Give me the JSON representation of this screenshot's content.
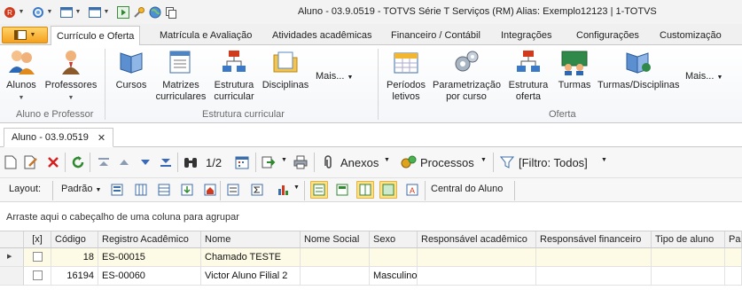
{
  "window": {
    "title": "Aluno - 03.9.0519 - TOTVS Série T Serviços (RM) Alias: Exemplo12123 | 1-TOTVS"
  },
  "quick_access": {
    "icons": [
      "refresh-icon",
      "window-icon",
      "window-icon",
      "play-icon",
      "settings-icon",
      "globe-icon",
      "copy-icon"
    ]
  },
  "ribbon": {
    "tabs": [
      "Currículo e Oferta",
      "Matrícula e Avaliação",
      "Atividades acadêmicas",
      "Financeiro / Contábil",
      "Integrações",
      "Configurações",
      "Customização"
    ],
    "active_tab": "Currículo e Oferta",
    "groups": {
      "aluno_prof": {
        "label": "Aluno e Professor",
        "buttons": [
          {
            "label": "Alunos",
            "icon": "students-icon"
          },
          {
            "label": "Professores",
            "icon": "teacher-icon"
          }
        ]
      },
      "estrutura": {
        "label": "Estrutura curricular",
        "buttons": [
          {
            "label": "Cursos",
            "icon": "book-icon"
          },
          {
            "label": "Matrizes",
            "label2": "curriculares",
            "icon": "matrix-icon"
          },
          {
            "label": "Estrutura",
            "label2": "curricular",
            "icon": "structure-icon"
          },
          {
            "label": "Disciplinas",
            "icon": "folder-icon"
          }
        ],
        "more": "Mais..."
      },
      "oferta": {
        "label": "Oferta",
        "buttons": [
          {
            "label": "Períodos",
            "label2": "letivos",
            "icon": "calendar-icon"
          },
          {
            "label": "Parametrização",
            "label2": "por curso",
            "icon": "gears-icon"
          },
          {
            "label": "Estrutura",
            "label2": "oferta",
            "icon": "structure-icon"
          },
          {
            "label": "Turmas",
            "icon": "class-icon"
          },
          {
            "label": "Turmas/Disciplinas",
            "icon": "class-books-icon"
          }
        ],
        "more": "Mais..."
      }
    }
  },
  "document_tab": {
    "label": "Aluno - 03.9.0519",
    "close": "✕"
  },
  "toolbar": {
    "page": "1/2",
    "anexos": "Anexos",
    "processos": "Processos",
    "filtro": "[Filtro: Todos]"
  },
  "toolbar2": {
    "layout_label": "Layout:",
    "layout_value": "Padrão",
    "central": "Central do Aluno"
  },
  "groupby_hint": "Arraste aqui o cabeçalho de uma coluna para agrupar",
  "grid": {
    "columns": [
      "[x]",
      "Código",
      "Registro Acadêmico",
      "Nome",
      "Nome Social",
      "Sexo",
      "Responsável acadêmico",
      "Responsável financeiro",
      "Tipo de aluno",
      "Pa"
    ],
    "rows": [
      {
        "codigo": "18",
        "registro": "ES-00015",
        "nome": "Chamado TESTE",
        "nome_social": "",
        "sexo": "",
        "selected": true
      },
      {
        "codigo": "16194",
        "registro": "ES-00060",
        "nome": "Victor Aluno Filial 2",
        "nome_social": "",
        "sexo": "Masculino",
        "selected": false
      }
    ]
  }
}
